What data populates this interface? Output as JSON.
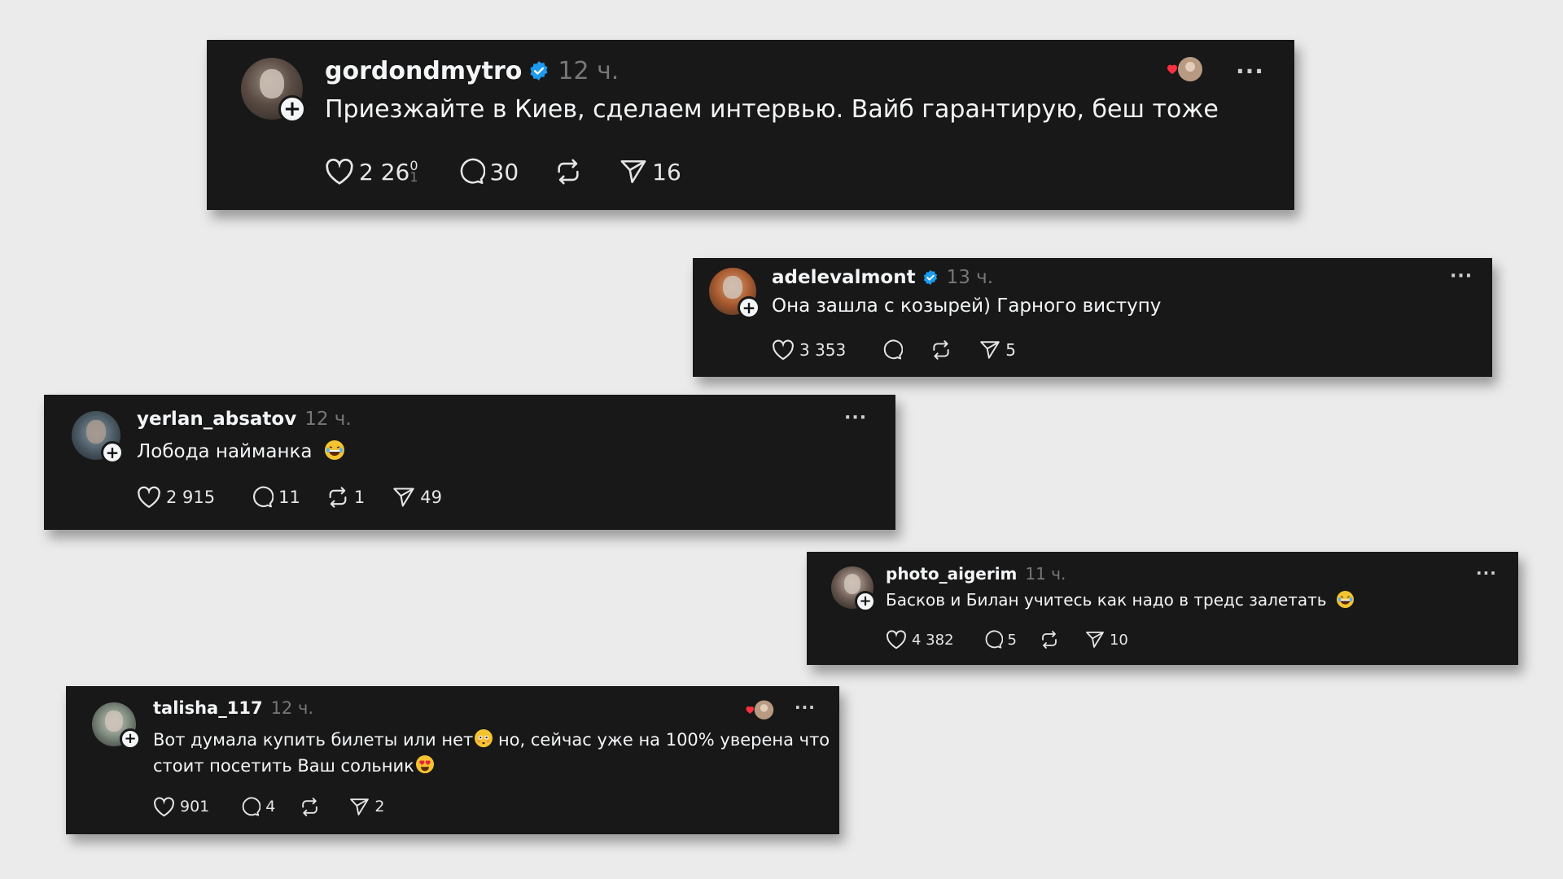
{
  "colors": {
    "background": "#ebebeb",
    "card": "#181818",
    "text": "#f3f5f7",
    "muted": "#777777",
    "verified": "#1d9bf0",
    "heart": "#ff3040"
  },
  "posts": [
    {
      "username": "gordondmytro",
      "verified": true,
      "time": "12 ч.",
      "text_lines": [
        "Приезжайте в Киев, сделаем интервью. Вайб гарантирую, беш тоже"
      ],
      "likes": "2 26",
      "likes_tail_top": "0",
      "likes_tail_bottom": "1",
      "comments": "30",
      "reposts": "",
      "shares": "16",
      "has_reaction_avatar": true,
      "more": "···"
    },
    {
      "username": "adelevalmont",
      "verified": true,
      "time": "13 ч.",
      "text_lines": [
        "Она зашла с козырей) Гарного виступу"
      ],
      "likes": "3 353",
      "comments": "",
      "reposts": "",
      "shares": "5",
      "more": "···"
    },
    {
      "username": "yerlan_absatov",
      "verified": false,
      "time": "12 ч.",
      "text_lines": [
        "Лобода найманка"
      ],
      "emoji": "laughing-face",
      "likes": "2 915",
      "comments": "11",
      "reposts": "1",
      "shares": "49",
      "more": "···"
    },
    {
      "username": "photo_aigerim",
      "verified": false,
      "time": "11 ч.",
      "text_lines": [
        "Басков и Билан учитесь как надо в тредс залетать"
      ],
      "emoji": "laughing-face",
      "likes": "4 382",
      "comments": "5",
      "reposts": "",
      "shares": "10",
      "more": "···"
    },
    {
      "username": "talisha_117",
      "verified": false,
      "time": "12 ч.",
      "text_line1_a": "Вот думала купить билеты или нет",
      "text_line1_b": " но, сейчас уже на 100% уверена что",
      "text_line2": "стоит посетить Ваш сольник",
      "likes": "901",
      "comments": "4",
      "reposts": "",
      "shares": "2",
      "has_reaction_avatar": true,
      "more": "···"
    }
  ]
}
